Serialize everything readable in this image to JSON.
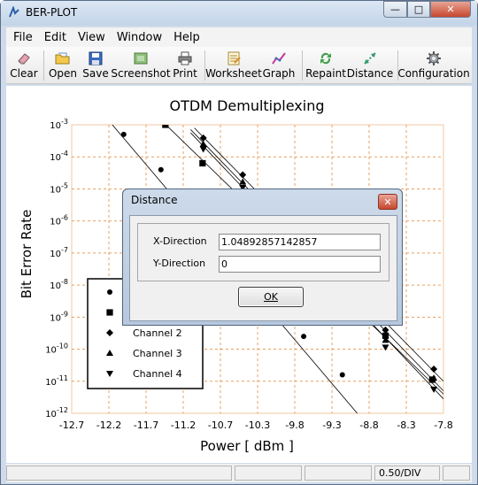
{
  "window": {
    "title": "BER-PLOT",
    "controls": {
      "minimize": "—",
      "maximize": "□",
      "close": "✕"
    }
  },
  "menubar": {
    "items": [
      "File",
      "Edit",
      "View",
      "Window",
      "Help"
    ]
  },
  "toolbar": {
    "buttons": [
      {
        "label": "Clear",
        "icon": "eraser-icon"
      },
      {
        "label": "Open",
        "icon": "open-folder-icon"
      },
      {
        "label": "Save",
        "icon": "floppy-disk-icon"
      },
      {
        "label": "Screenshot",
        "icon": "screenshot-icon"
      },
      {
        "label": "Print",
        "icon": "printer-icon"
      },
      {
        "label": "Worksheet",
        "icon": "worksheet-icon"
      },
      {
        "label": "Graph",
        "icon": "graph-icon"
      },
      {
        "label": "Repaint",
        "icon": "repaint-icon"
      },
      {
        "label": "Distance",
        "icon": "distance-icon"
      },
      {
        "label": "Configuration",
        "icon": "gear-icon"
      }
    ]
  },
  "chart_data": {
    "type": "scatter",
    "title": "OTDM Demultiplexing",
    "xlabel": "Power [ dBm ]",
    "ylabel": "Bit Error Rate",
    "xlim": [
      -12.7,
      -7.7
    ],
    "ylim": [
      -12,
      -3
    ],
    "x_ticks": [
      "-12.7",
      "-12.2",
      "-11.7",
      "-11.2",
      "-10.7",
      "-10.3",
      "-9.8",
      "-9.3",
      "-8.8",
      "-8.3",
      "-7.8"
    ],
    "y_ticks": [
      {
        "value": -3,
        "base": "10",
        "exp": "-3"
      },
      {
        "value": -4,
        "base": "10",
        "exp": "-4"
      },
      {
        "value": -5,
        "base": "10",
        "exp": "-5"
      },
      {
        "value": -6,
        "base": "10",
        "exp": "-6"
      },
      {
        "value": -7,
        "base": "10",
        "exp": "-7"
      },
      {
        "value": -8,
        "base": "10",
        "exp": "-8"
      },
      {
        "value": -9,
        "base": "10",
        "exp": "-9"
      },
      {
        "value": -10,
        "base": "10",
        "exp": "-10"
      },
      {
        "value": -11,
        "base": "10",
        "exp": "-11"
      },
      {
        "value": -12,
        "base": "10",
        "exp": "-12"
      }
    ],
    "grid": true,
    "legend_position": "lower-left",
    "series": [
      {
        "name": "",
        "marker": "circle",
        "points": [
          [
            -12.0,
            -3.3
          ],
          [
            -11.5,
            -4.4
          ],
          [
            -9.58,
            -9.6
          ],
          [
            -9.06,
            -10.8
          ]
        ],
        "line": [
          [
            -12.3,
            -2.6
          ],
          [
            -8.75,
            -12.3
          ]
        ]
      },
      {
        "name": "",
        "marker": "square",
        "points": [
          [
            -11.44,
            -3.0
          ],
          [
            -10.94,
            -4.2
          ],
          [
            -8.48,
            -9.58
          ],
          [
            -7.85,
            -10.95
          ]
        ],
        "line": [
          [
            -11.5,
            -2.85
          ],
          [
            -7.7,
            -11.4
          ]
        ]
      },
      {
        "name": "Channel 2",
        "marker": "diamond",
        "points": [
          [
            -10.93,
            -3.41
          ],
          [
            -10.4,
            -4.56
          ],
          [
            -8.48,
            -9.4
          ],
          [
            -7.83,
            -10.62
          ]
        ],
        "line": [
          [
            -11.05,
            -3.1
          ],
          [
            -7.7,
            -11.0
          ]
        ]
      },
      {
        "name": "Channel 3",
        "marker": "triangle-up",
        "points": [
          [
            -10.93,
            -3.6
          ],
          [
            -10.4,
            -4.78
          ],
          [
            -8.48,
            -9.72
          ],
          [
            -7.83,
            -10.9
          ]
        ],
        "line": [
          [
            -11.1,
            -3.15
          ],
          [
            -7.7,
            -11.3
          ]
        ]
      },
      {
        "name": "Channel 4",
        "marker": "triangle-down",
        "points": [
          [
            -10.93,
            -3.76
          ],
          [
            -10.4,
            -4.96
          ],
          [
            -8.48,
            -9.94
          ],
          [
            -7.83,
            -11.25
          ]
        ],
        "line": [
          [
            -11.1,
            -3.25
          ],
          [
            -7.7,
            -11.55
          ]
        ]
      }
    ]
  },
  "dialog": {
    "title": "Distance",
    "close": "✕",
    "x_label": "X-Direction",
    "x_value": "1.04892857142857",
    "y_label": "Y-Direction",
    "y_value": "0",
    "ok_label": "OK"
  },
  "statusbar": {
    "scale": "0.50/DIV"
  }
}
